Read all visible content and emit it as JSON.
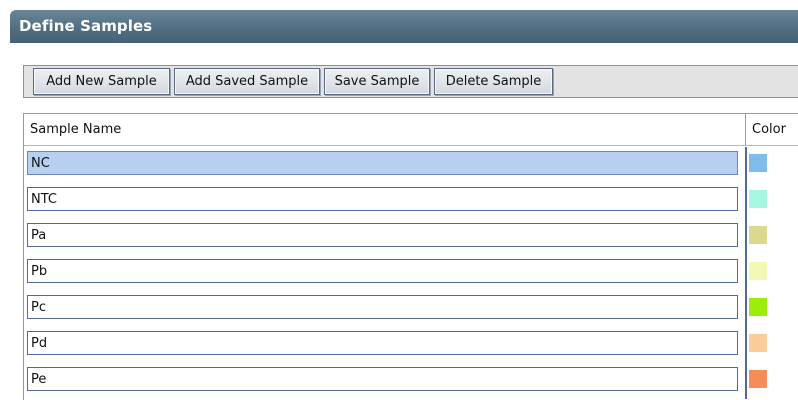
{
  "panel": {
    "title": "Define Samples"
  },
  "toolbar": {
    "buttons": [
      {
        "label": "Add New Sample"
      },
      {
        "label": "Add Saved Sample"
      },
      {
        "label": "Save Sample"
      },
      {
        "label": "Delete Sample"
      }
    ]
  },
  "table": {
    "columns": {
      "name": "Sample Name",
      "color": "Color"
    },
    "selected_index": 0,
    "rows": [
      {
        "name": "NC",
        "color": "#7fbcec"
      },
      {
        "name": "NTC",
        "color": "#a6f7e2"
      },
      {
        "name": "Pa",
        "color": "#dcd98e"
      },
      {
        "name": "Pb",
        "color": "#f3f8b2"
      },
      {
        "name": "Pc",
        "color": "#9ced0c"
      },
      {
        "name": "Pd",
        "color": "#fbcc9a"
      },
      {
        "name": "Pe",
        "color": "#f68d58"
      }
    ]
  }
}
